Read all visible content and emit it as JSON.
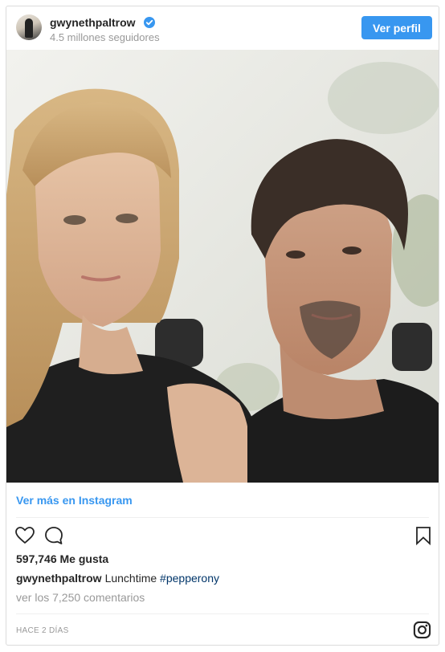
{
  "header": {
    "username": "gwynethpaltrow",
    "followers": "4.5 millones seguidores",
    "profile_button": "Ver perfil"
  },
  "post": {
    "view_more": "Ver más en Instagram",
    "likes": "597,746 Me gusta",
    "caption_user": "gwynethpaltrow",
    "caption_text": "Lunchtime",
    "caption_hashtag": "#pepperony",
    "comments_link": "ver los 7,250 comentarios",
    "timestamp": "HACE 2 DÍAS"
  },
  "colors": {
    "accent": "#3897f0",
    "hashtag": "#003569",
    "muted": "#999999",
    "border": "#dbdbdb"
  },
  "icons": [
    "verified-badge-icon",
    "heart-icon",
    "comment-icon",
    "bookmark-icon",
    "instagram-logo-icon"
  ]
}
